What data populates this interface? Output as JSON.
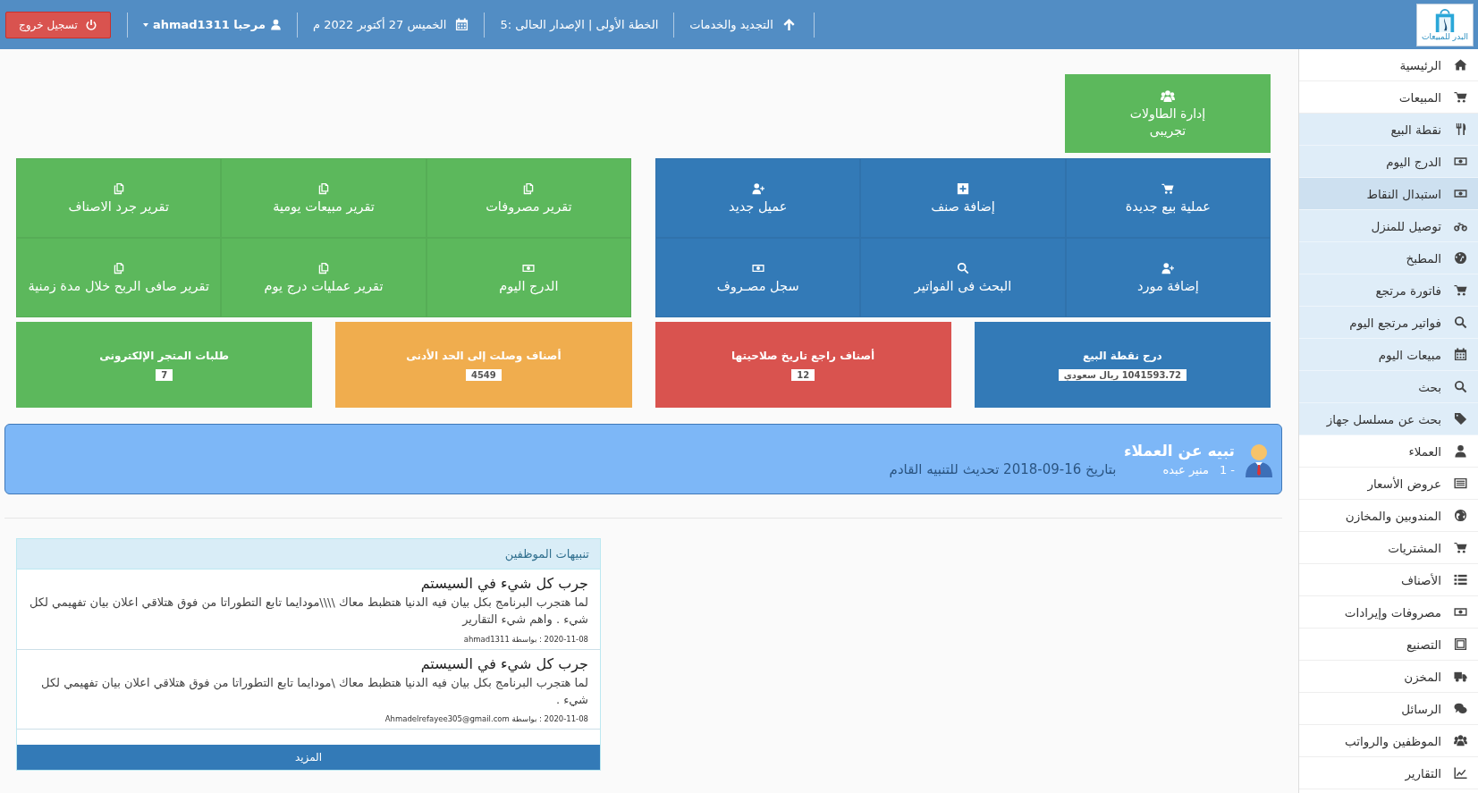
{
  "topbar": {
    "logo_text": "البدر للمبيعات",
    "nav": [
      {
        "kind": "arrow-up",
        "label": "التجديد والخدمات"
      },
      {
        "kind": "plain",
        "label": "الخطة الأولى | الإصدار الحالى :5"
      },
      {
        "kind": "calendar",
        "label": "الخميس 27 أكتوبر 2022 م"
      }
    ],
    "user": "مرحبا ahmad1311",
    "logout": "تسجيل خروج"
  },
  "sidebar": {
    "items": [
      {
        "kind": "home",
        "label": "الرئيسية",
        "selected": false
      },
      {
        "kind": "cart",
        "label": "المبيعات",
        "selected": false,
        "expanded": true,
        "children": [
          {
            "kind": "cutlery",
            "label": "نقطة البيع",
            "selected": false
          },
          {
            "kind": "banknote",
            "label": "الدرج اليوم",
            "selected": false
          },
          {
            "kind": "banknote",
            "label": "استبدال النقاط",
            "selected": true
          },
          {
            "kind": "motorcycle",
            "label": "توصيل للمنزل",
            "selected": false
          },
          {
            "kind": "gauge",
            "label": "المطبخ",
            "selected": false
          },
          {
            "kind": "cart",
            "label": "فاتورة مرتجع",
            "selected": false
          },
          {
            "kind": "search",
            "label": "فواتير مرتجع اليوم",
            "selected": false
          },
          {
            "kind": "calendar",
            "label": "مبيعات اليوم",
            "selected": false
          },
          {
            "kind": "search",
            "label": "بحث",
            "selected": false
          },
          {
            "kind": "tag",
            "label": "بحث عن مسلسل جهاز",
            "selected": false
          }
        ]
      },
      {
        "kind": "user",
        "label": "العملاء",
        "selected": false
      },
      {
        "kind": "list-alt",
        "label": "عروض الأسعار",
        "selected": false
      },
      {
        "kind": "globe",
        "label": "المندوبين والمخازن",
        "selected": false
      },
      {
        "kind": "cart",
        "label": "المشتريات",
        "selected": false
      },
      {
        "kind": "list",
        "label": "الأصناف",
        "selected": false
      },
      {
        "kind": "banknote",
        "label": "مصروفات وإيرادات",
        "selected": false
      },
      {
        "kind": "frame",
        "label": "التصنيع",
        "selected": false
      },
      {
        "kind": "truck",
        "label": "المخزن",
        "selected": false
      },
      {
        "kind": "chat",
        "label": "الرسائل",
        "selected": false
      },
      {
        "kind": "users",
        "label": "الموظفين والرواتب",
        "selected": false
      },
      {
        "kind": "chart",
        "label": "التقارير",
        "selected": false
      }
    ]
  },
  "table_tile": {
    "kind": "users",
    "label": "إدارة الطاولات",
    "sublabel": "تجريبى"
  },
  "blue_tiles": [
    {
      "kind": "cart",
      "label": "عملية بيع جديدة"
    },
    {
      "kind": "plus-square",
      "label": "إضافة صنف"
    },
    {
      "kind": "user-plus",
      "label": "عميل جديد"
    },
    {
      "kind": "user-plus",
      "label": "إضافة مورد"
    },
    {
      "kind": "search",
      "label": "البحث فى الفواتير"
    },
    {
      "kind": "banknote",
      "label": "سجل مصـروف"
    }
  ],
  "green_tiles": [
    {
      "kind": "copy",
      "label": "تقرير مصروفات"
    },
    {
      "kind": "copy",
      "label": "تقرير مبيعات يومية"
    },
    {
      "kind": "copy",
      "label": "تقرير جرد الاصناف"
    },
    {
      "kind": "banknote",
      "label": "الدرج اليوم"
    },
    {
      "kind": "copy",
      "label": "تقرير عمليات درج يوم"
    },
    {
      "kind": "copy",
      "label": "تقرير صافى الربح خلال مدة زمنية"
    }
  ],
  "stats": [
    {
      "title": "درج نقطة البيع",
      "value": "1041593.72 ريال سعودي",
      "color": "#337ab7"
    },
    {
      "title": "أصناف راجع تاريخ صلاحيتها",
      "value": "12",
      "color": "#d9534f"
    },
    {
      "title": "أصناف وصلت إلى الحد الأدنى",
      "value": "4549",
      "color": "#f0ad4e"
    },
    {
      "title": "طلبات المتجر الإلكترونى",
      "value": "7",
      "color": "#5cb85c"
    }
  ],
  "alert": {
    "title": "تبيه عن العملاء",
    "number": "- 1",
    "name": "منير عبده",
    "message": "بتاريخ 16-09-2018 تحديث للتنبيه القادم"
  },
  "notices": {
    "title": "تنبيهات الموظفين",
    "items": [
      {
        "title": "جرب كل شيء في السيستم",
        "body": "لما هتجرب البرنامج بكل بيان فيه الدنيا هتظبط معاك \\\\\\\\مودايما تابع التطوراتا من فوق هتلاقي اعلان بيان تفهيمي لكل شيء . واهم شيء التقارير",
        "meta": "2020-11-08 : بواسطة ahmad1311"
      },
      {
        "title": "جرب كل شيء في السيستم",
        "body": "لما هتجرب البرنامج بكل بيان فيه الدنيا هتظبط معاك \\مودايما تابع التطوراتا من فوق هتلاقي اعلان بيان تفهيمي لكل شيء .",
        "meta": "2020-11-08 : بواسطة Ahmadelrefayee305@gmail.com"
      }
    ],
    "more": "المزيد"
  }
}
